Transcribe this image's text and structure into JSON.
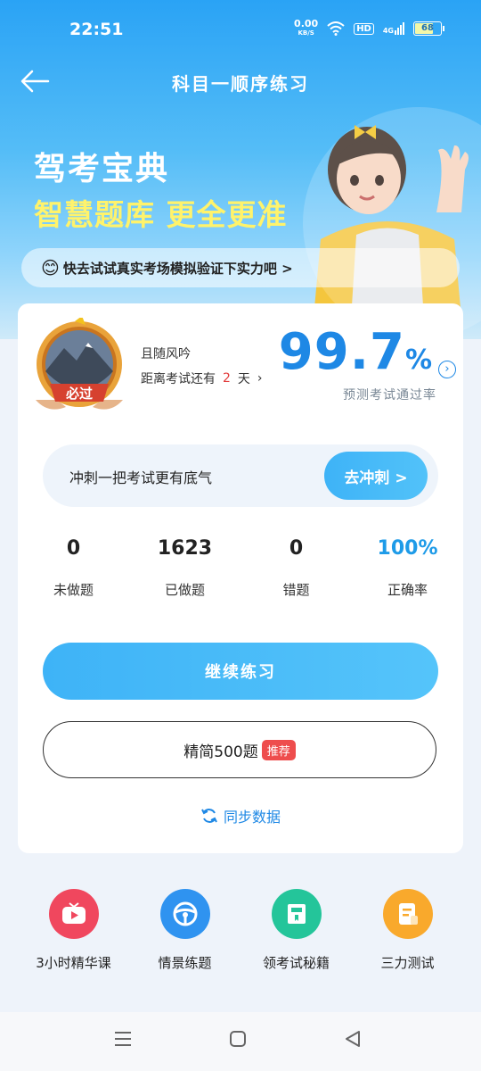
{
  "status_bar": {
    "time": "22:51",
    "net_speed": "0.00",
    "net_unit": "KB/S",
    "hd": "HD",
    "signal": "4G",
    "battery": "68"
  },
  "navbar": {
    "title": "科目一顺序练习"
  },
  "banner": {
    "line1": "驾考宝典",
    "line2": "智慧题库 更全更准",
    "promo": "快去试试真实考场模拟验证下实力吧 >"
  },
  "profile": {
    "medal_text": "必过",
    "name": "且随风吟",
    "countdown_prefix": "距离考试还有",
    "days": "2",
    "countdown_suffix": "天"
  },
  "prediction": {
    "rate": "99.7",
    "unit": "%",
    "label": "预测考试通过率"
  },
  "sprint": {
    "text": "冲刺一把考试更有底气",
    "button": "去冲刺 >"
  },
  "stats": [
    {
      "value": "0",
      "label": "未做题"
    },
    {
      "value": "1623",
      "label": "已做题"
    },
    {
      "value": "0",
      "label": "错题"
    },
    {
      "value": "100%",
      "label": "正确率"
    }
  ],
  "actions": {
    "continue": "继续练习",
    "lite": "精简500题",
    "lite_tag": "推荐",
    "sync": "同步数据"
  },
  "tools": [
    {
      "label": "3小时精华课",
      "icon": "tv-icon",
      "color": "#f0475e"
    },
    {
      "label": "情景练题",
      "icon": "steering-wheel-icon",
      "color": "#2f93f0"
    },
    {
      "label": "领考试秘籍",
      "icon": "book-icon",
      "color": "#24c59a"
    },
    {
      "label": "三力测试",
      "icon": "document-icon",
      "color": "#f9a92c"
    }
  ]
}
